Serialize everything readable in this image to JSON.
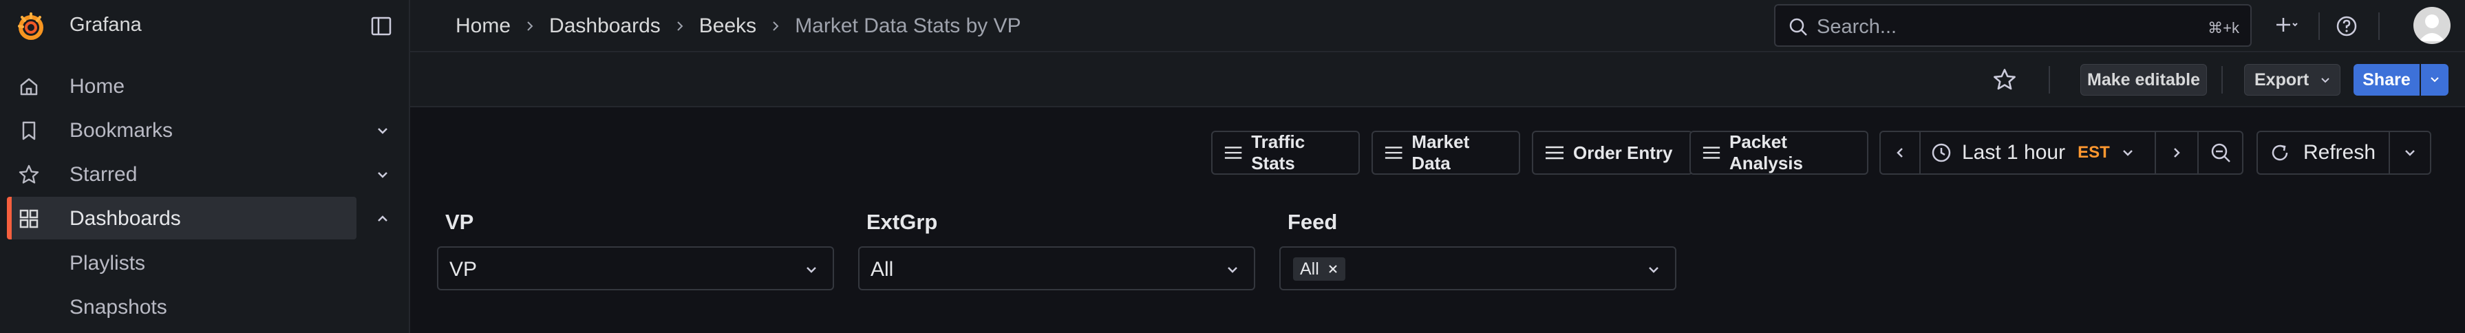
{
  "app": {
    "brand": "Grafana",
    "accent": "#f55f3e",
    "primary": "#3d71d9"
  },
  "sidebar": {
    "items": [
      {
        "label": "Home",
        "icon": "home-icon"
      },
      {
        "label": "Bookmarks",
        "icon": "bookmark-icon"
      },
      {
        "label": "Starred",
        "icon": "star-icon"
      },
      {
        "label": "Dashboards",
        "icon": "dashboards-grid-icon",
        "active": true
      }
    ],
    "sub_items": [
      {
        "label": "Playlists"
      },
      {
        "label": "Snapshots"
      }
    ]
  },
  "breadcrumbs": [
    "Home",
    "Dashboards",
    "Beeks",
    "Market Data Stats by VP"
  ],
  "search": {
    "placeholder": "Search...",
    "shortcut": "⌘+k"
  },
  "toolbar": {
    "make_editable": "Make editable",
    "export": "Export",
    "share": "Share"
  },
  "links": [
    "Traffic Stats",
    "Market Data",
    "Order Entry",
    "Packet Analysis"
  ],
  "time": {
    "range": "Last 1 hour",
    "timezone": "EST",
    "timezone_color": "#ff9830",
    "refresh": "Refresh"
  },
  "variables": [
    {
      "label": "VP",
      "value": "VP"
    },
    {
      "label": "ExtGrp",
      "value": "All"
    },
    {
      "label": "Feed",
      "tag": "All"
    }
  ]
}
